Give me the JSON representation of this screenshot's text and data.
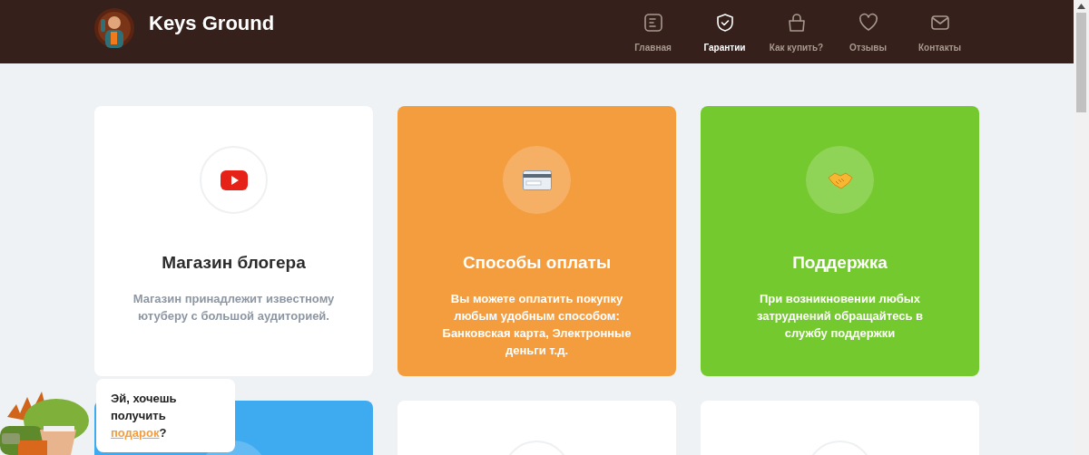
{
  "header": {
    "brand": "Keys Ground",
    "nav": [
      {
        "label": "Главная",
        "selected": false
      },
      {
        "label": "Гарантии",
        "selected": true
      },
      {
        "label": "Как купить?",
        "selected": false
      },
      {
        "label": "Отзывы",
        "selected": false
      },
      {
        "label": "Контакты",
        "selected": false
      }
    ]
  },
  "cards": [
    {
      "kind": "light",
      "color": "#ffffff",
      "title": "Магазин блогера",
      "text": "Магазин принадлежит известному ютуберу с большой аудиторией."
    },
    {
      "kind": "filled",
      "color": "#f49d3f",
      "title": "Способы оплаты",
      "text": "Вы можете оплатить покупку любым удобным способом: Банковская карта, Электронные деньги т.д."
    },
    {
      "kind": "filled",
      "color": "#74c92e",
      "title": "Поддержка",
      "text": "При возникновении любых затруднений обращайтесь в службу поддержки"
    },
    {
      "kind": "filled",
      "color": "#3eaaf0"
    },
    {
      "kind": "light",
      "color": "#ffffff"
    },
    {
      "kind": "light",
      "color": "#ffffff"
    }
  ],
  "chat_bubble": {
    "text_before": "Эй, хочешь получить ",
    "link": "подарок",
    "text_after": "?"
  }
}
